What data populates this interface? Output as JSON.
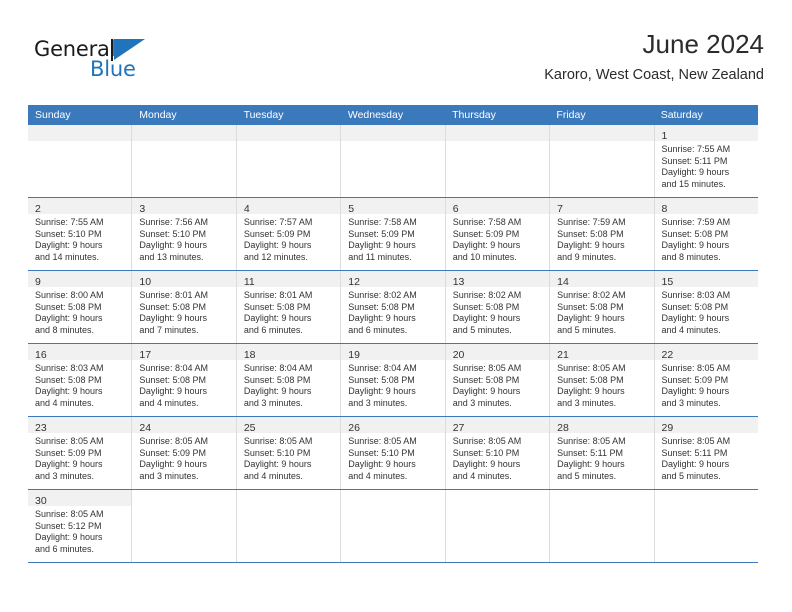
{
  "brand": {
    "name_part1": "General",
    "name_part2": "Blue",
    "logo_icon": "flag-triangle-icon",
    "accent_color": "#1f74bb"
  },
  "header": {
    "title": "June 2024",
    "subtitle": "Karoro, West Coast, New Zealand"
  },
  "calendar": {
    "header_bg_color": "#3b79bd",
    "daynum_strip_color": "#f1f1f1",
    "weekday_headers": [
      "Sunday",
      "Monday",
      "Tuesday",
      "Wednesday",
      "Thursday",
      "Friday",
      "Saturday"
    ],
    "weeks": [
      {
        "days": [
          {
            "empty": true
          },
          {
            "empty": true
          },
          {
            "empty": true
          },
          {
            "empty": true
          },
          {
            "empty": true
          },
          {
            "empty": true
          },
          {
            "day": "1",
            "sunrise": "Sunrise: 7:55 AM",
            "sunset": "Sunset: 5:11 PM",
            "daylight_l1": "Daylight: 9 hours",
            "daylight_l2": "and 15 minutes."
          }
        ]
      },
      {
        "days": [
          {
            "day": "2",
            "sunrise": "Sunrise: 7:55 AM",
            "sunset": "Sunset: 5:10 PM",
            "daylight_l1": "Daylight: 9 hours",
            "daylight_l2": "and 14 minutes."
          },
          {
            "day": "3",
            "sunrise": "Sunrise: 7:56 AM",
            "sunset": "Sunset: 5:10 PM",
            "daylight_l1": "Daylight: 9 hours",
            "daylight_l2": "and 13 minutes."
          },
          {
            "day": "4",
            "sunrise": "Sunrise: 7:57 AM",
            "sunset": "Sunset: 5:09 PM",
            "daylight_l1": "Daylight: 9 hours",
            "daylight_l2": "and 12 minutes."
          },
          {
            "day": "5",
            "sunrise": "Sunrise: 7:58 AM",
            "sunset": "Sunset: 5:09 PM",
            "daylight_l1": "Daylight: 9 hours",
            "daylight_l2": "and 11 minutes."
          },
          {
            "day": "6",
            "sunrise": "Sunrise: 7:58 AM",
            "sunset": "Sunset: 5:09 PM",
            "daylight_l1": "Daylight: 9 hours",
            "daylight_l2": "and 10 minutes."
          },
          {
            "day": "7",
            "sunrise": "Sunrise: 7:59 AM",
            "sunset": "Sunset: 5:08 PM",
            "daylight_l1": "Daylight: 9 hours",
            "daylight_l2": "and 9 minutes."
          },
          {
            "day": "8",
            "sunrise": "Sunrise: 7:59 AM",
            "sunset": "Sunset: 5:08 PM",
            "daylight_l1": "Daylight: 9 hours",
            "daylight_l2": "and 8 minutes."
          }
        ]
      },
      {
        "days": [
          {
            "day": "9",
            "sunrise": "Sunrise: 8:00 AM",
            "sunset": "Sunset: 5:08 PM",
            "daylight_l1": "Daylight: 9 hours",
            "daylight_l2": "and 8 minutes."
          },
          {
            "day": "10",
            "sunrise": "Sunrise: 8:01 AM",
            "sunset": "Sunset: 5:08 PM",
            "daylight_l1": "Daylight: 9 hours",
            "daylight_l2": "and 7 minutes."
          },
          {
            "day": "11",
            "sunrise": "Sunrise: 8:01 AM",
            "sunset": "Sunset: 5:08 PM",
            "daylight_l1": "Daylight: 9 hours",
            "daylight_l2": "and 6 minutes."
          },
          {
            "day": "12",
            "sunrise": "Sunrise: 8:02 AM",
            "sunset": "Sunset: 5:08 PM",
            "daylight_l1": "Daylight: 9 hours",
            "daylight_l2": "and 6 minutes."
          },
          {
            "day": "13",
            "sunrise": "Sunrise: 8:02 AM",
            "sunset": "Sunset: 5:08 PM",
            "daylight_l1": "Daylight: 9 hours",
            "daylight_l2": "and 5 minutes."
          },
          {
            "day": "14",
            "sunrise": "Sunrise: 8:02 AM",
            "sunset": "Sunset: 5:08 PM",
            "daylight_l1": "Daylight: 9 hours",
            "daylight_l2": "and 5 minutes."
          },
          {
            "day": "15",
            "sunrise": "Sunrise: 8:03 AM",
            "sunset": "Sunset: 5:08 PM",
            "daylight_l1": "Daylight: 9 hours",
            "daylight_l2": "and 4 minutes."
          }
        ]
      },
      {
        "days": [
          {
            "day": "16",
            "sunrise": "Sunrise: 8:03 AM",
            "sunset": "Sunset: 5:08 PM",
            "daylight_l1": "Daylight: 9 hours",
            "daylight_l2": "and 4 minutes."
          },
          {
            "day": "17",
            "sunrise": "Sunrise: 8:04 AM",
            "sunset": "Sunset: 5:08 PM",
            "daylight_l1": "Daylight: 9 hours",
            "daylight_l2": "and 4 minutes."
          },
          {
            "day": "18",
            "sunrise": "Sunrise: 8:04 AM",
            "sunset": "Sunset: 5:08 PM",
            "daylight_l1": "Daylight: 9 hours",
            "daylight_l2": "and 3 minutes."
          },
          {
            "day": "19",
            "sunrise": "Sunrise: 8:04 AM",
            "sunset": "Sunset: 5:08 PM",
            "daylight_l1": "Daylight: 9 hours",
            "daylight_l2": "and 3 minutes."
          },
          {
            "day": "20",
            "sunrise": "Sunrise: 8:05 AM",
            "sunset": "Sunset: 5:08 PM",
            "daylight_l1": "Daylight: 9 hours",
            "daylight_l2": "and 3 minutes."
          },
          {
            "day": "21",
            "sunrise": "Sunrise: 8:05 AM",
            "sunset": "Sunset: 5:08 PM",
            "daylight_l1": "Daylight: 9 hours",
            "daylight_l2": "and 3 minutes."
          },
          {
            "day": "22",
            "sunrise": "Sunrise: 8:05 AM",
            "sunset": "Sunset: 5:09 PM",
            "daylight_l1": "Daylight: 9 hours",
            "daylight_l2": "and 3 minutes."
          }
        ]
      },
      {
        "days": [
          {
            "day": "23",
            "sunrise": "Sunrise: 8:05 AM",
            "sunset": "Sunset: 5:09 PM",
            "daylight_l1": "Daylight: 9 hours",
            "daylight_l2": "and 3 minutes."
          },
          {
            "day": "24",
            "sunrise": "Sunrise: 8:05 AM",
            "sunset": "Sunset: 5:09 PM",
            "daylight_l1": "Daylight: 9 hours",
            "daylight_l2": "and 3 minutes."
          },
          {
            "day": "25",
            "sunrise": "Sunrise: 8:05 AM",
            "sunset": "Sunset: 5:10 PM",
            "daylight_l1": "Daylight: 9 hours",
            "daylight_l2": "and 4 minutes."
          },
          {
            "day": "26",
            "sunrise": "Sunrise: 8:05 AM",
            "sunset": "Sunset: 5:10 PM",
            "daylight_l1": "Daylight: 9 hours",
            "daylight_l2": "and 4 minutes."
          },
          {
            "day": "27",
            "sunrise": "Sunrise: 8:05 AM",
            "sunset": "Sunset: 5:10 PM",
            "daylight_l1": "Daylight: 9 hours",
            "daylight_l2": "and 4 minutes."
          },
          {
            "day": "28",
            "sunrise": "Sunrise: 8:05 AM",
            "sunset": "Sunset: 5:11 PM",
            "daylight_l1": "Daylight: 9 hours",
            "daylight_l2": "and 5 minutes."
          },
          {
            "day": "29",
            "sunrise": "Sunrise: 8:05 AM",
            "sunset": "Sunset: 5:11 PM",
            "daylight_l1": "Daylight: 9 hours",
            "daylight_l2": "and 5 minutes."
          }
        ]
      },
      {
        "days": [
          {
            "day": "30",
            "sunrise": "Sunrise: 8:05 AM",
            "sunset": "Sunset: 5:12 PM",
            "daylight_l1": "Daylight: 9 hours",
            "daylight_l2": "and 6 minutes."
          },
          {
            "blank": true
          },
          {
            "blank": true
          },
          {
            "blank": true
          },
          {
            "blank": true
          },
          {
            "blank": true
          },
          {
            "blank": true
          }
        ]
      }
    ]
  }
}
